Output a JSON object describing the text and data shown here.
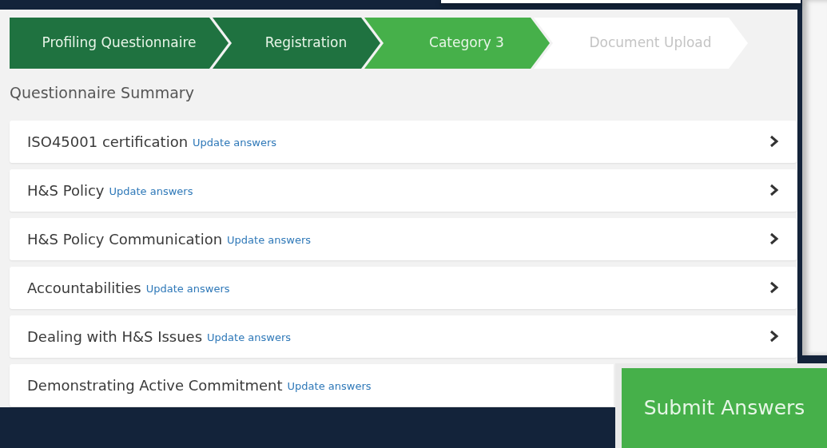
{
  "steps": [
    {
      "label": "Profiling Questionnaire",
      "kind": "done"
    },
    {
      "label": "Registration",
      "kind": "done"
    },
    {
      "label": "Category 3",
      "kind": "current"
    },
    {
      "label": "Document Upload",
      "kind": "todo"
    }
  ],
  "summary": {
    "title": "Questionnaire Summary",
    "items": [
      {
        "title": "ISO45001 certification",
        "link": "Update answers"
      },
      {
        "title": "H&S Policy",
        "link": "Update answers"
      },
      {
        "title": "H&S Policy Communication",
        "link": "Update answers"
      },
      {
        "title": "Accountabilities",
        "link": "Update answers"
      },
      {
        "title": "Dealing with H&S Issues",
        "link": "Update answers"
      },
      {
        "title": "Demonstrating Active Commitment",
        "link": "Update answers"
      }
    ]
  },
  "submit_button": "Submit Answers"
}
